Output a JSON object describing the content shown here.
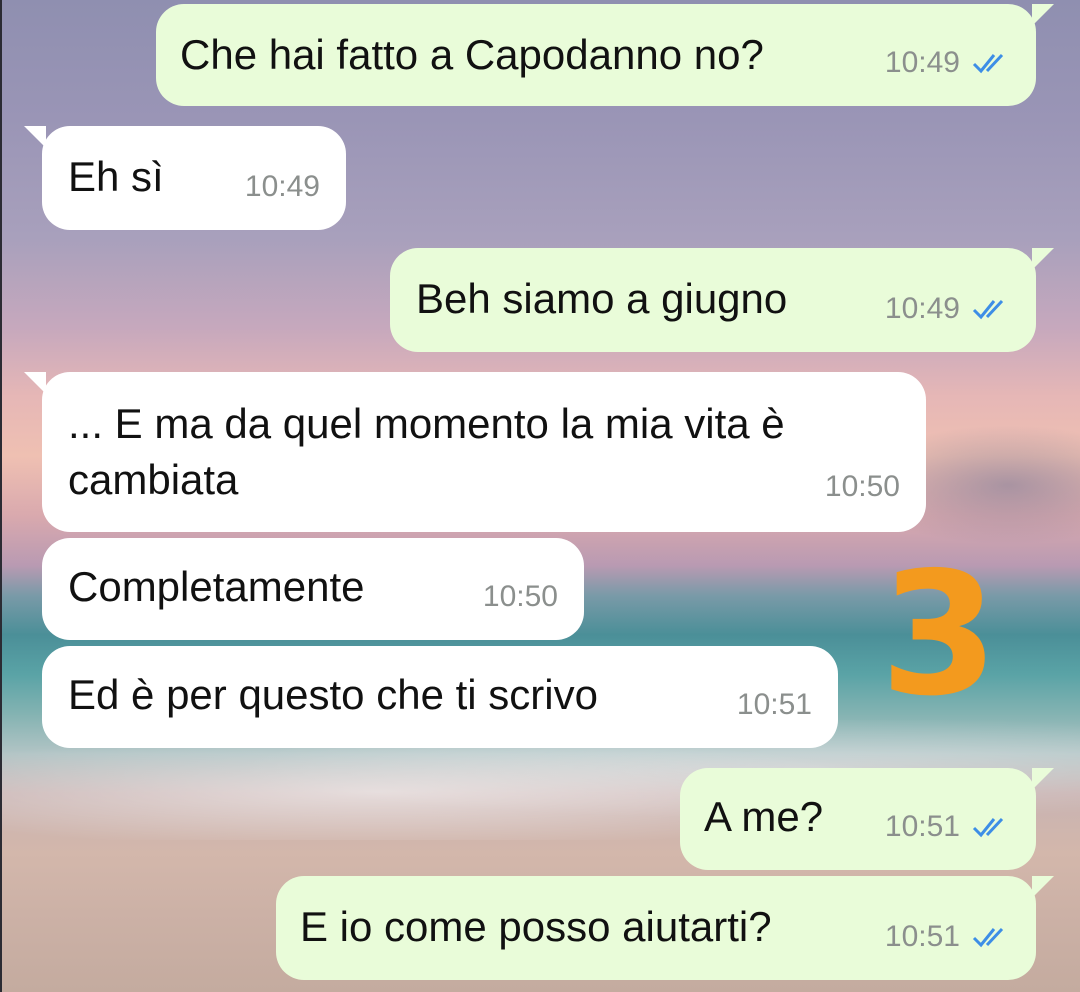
{
  "chat": {
    "messages": [
      {
        "direction": "outgoing",
        "text": "Che hai fatto a Capodanno no?",
        "time": "10:49",
        "status_icon": "double-check-icon"
      },
      {
        "direction": "incoming",
        "text": "Eh sì",
        "time": "10:49"
      },
      {
        "direction": "outgoing",
        "text": "Beh siamo a giugno",
        "time": "10:49",
        "status_icon": "double-check-icon"
      },
      {
        "direction": "incoming",
        "text": "... E ma da quel momento la mia vita è\ncambiata",
        "time": "10:50"
      },
      {
        "direction": "incoming",
        "text": "Completamente",
        "time": "10:50"
      },
      {
        "direction": "incoming",
        "text": "Ed è per questo che ti scrivo",
        "time": "10:51"
      },
      {
        "direction": "outgoing",
        "text": "A me?",
        "time": "10:51",
        "status_icon": "double-check-icon"
      },
      {
        "direction": "outgoing",
        "text": "E io come posso aiutarti?",
        "time": "10:51",
        "status_icon": "double-check-icon"
      }
    ],
    "annotation": "3"
  },
  "colors": {
    "outgoing_bubble": "#e9fcd9",
    "incoming_bubble": "#ffffff",
    "read_ticks": "#3d8ee6",
    "timestamp": "#8b8f8d",
    "annotation": "#f39a1e"
  }
}
